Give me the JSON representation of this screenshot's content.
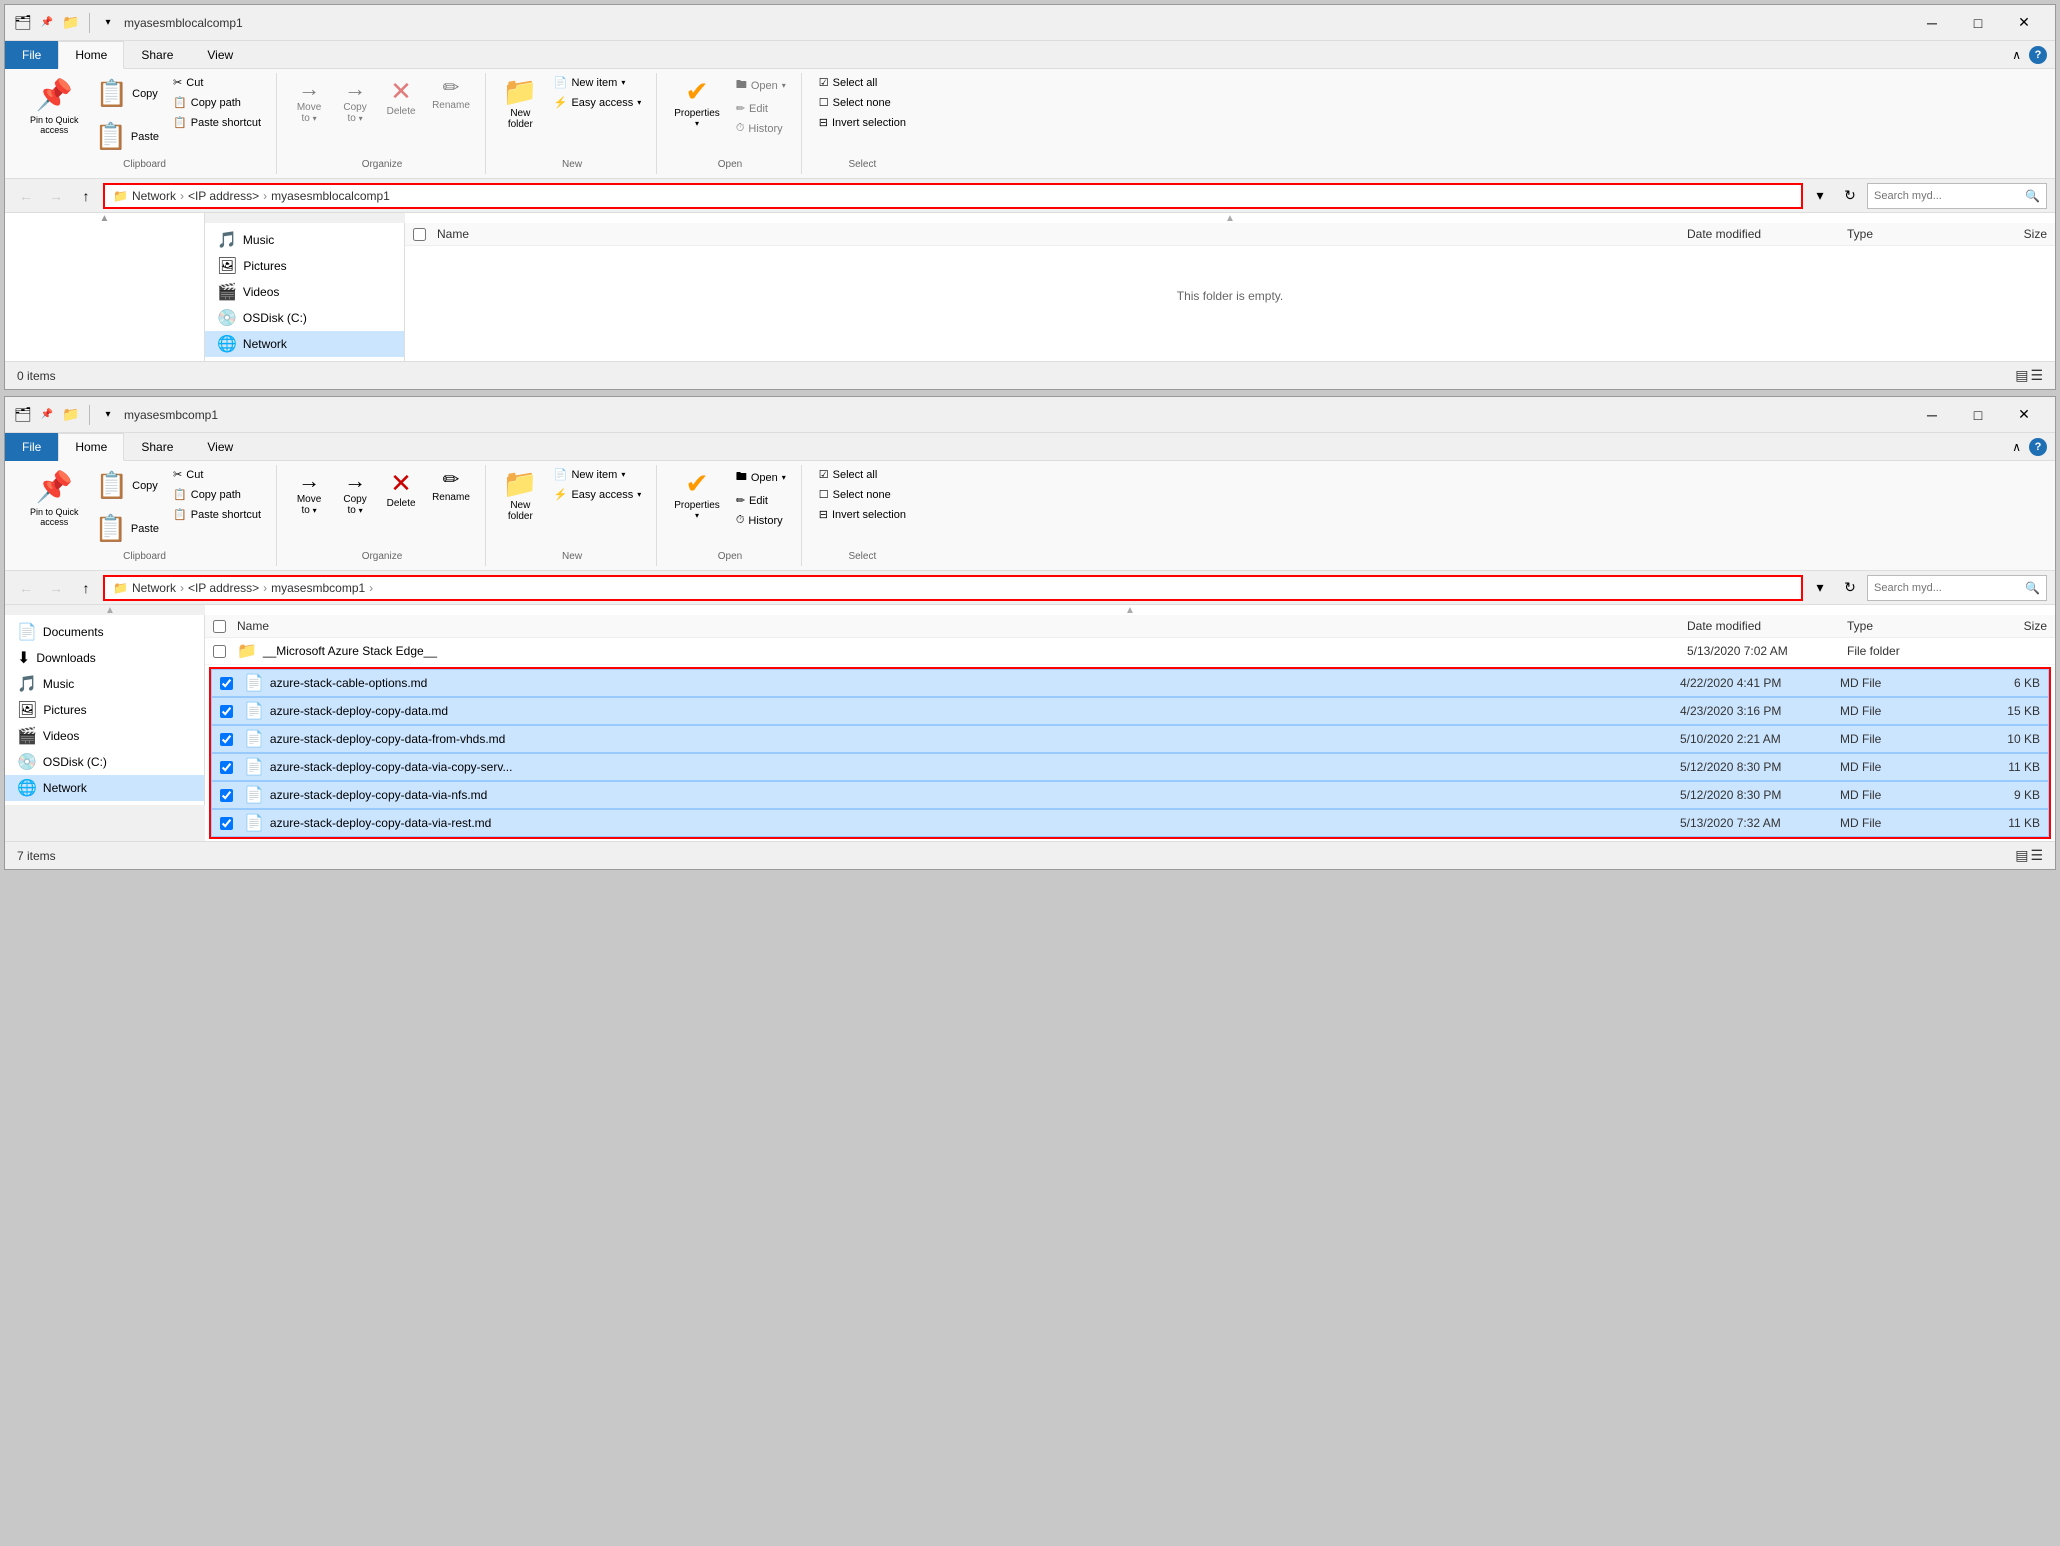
{
  "window1": {
    "title": "myasesmblocalcomp1",
    "tabs": [
      "File",
      "Home",
      "Share",
      "View"
    ],
    "active_tab": "Home",
    "ribbon": {
      "groups": {
        "clipboard": {
          "label": "Clipboard",
          "buttons": [
            {
              "id": "pin",
              "icon": "📌",
              "label": "Pin to Quick\naccess"
            },
            {
              "id": "copy",
              "icon": "📋",
              "label": "Copy"
            },
            {
              "id": "paste",
              "icon": "📋",
              "label": "Paste"
            }
          ],
          "small_buttons": [
            {
              "id": "cut",
              "icon": "✂",
              "label": "Cut"
            },
            {
              "id": "copy-path",
              "icon": "📋",
              "label": "Copy path"
            },
            {
              "id": "paste-shortcut",
              "icon": "📋",
              "label": "Paste shortcut"
            }
          ]
        },
        "organize": {
          "label": "Organize",
          "buttons": [
            {
              "id": "move-to",
              "icon": "→",
              "label": "Move to"
            },
            {
              "id": "copy-to",
              "icon": "→",
              "label": "Copy to"
            },
            {
              "id": "delete",
              "icon": "✕",
              "label": "Delete"
            },
            {
              "id": "rename",
              "icon": "✏",
              "label": "Rename"
            }
          ]
        },
        "new": {
          "label": "New",
          "buttons": [
            {
              "id": "new-folder",
              "icon": "📁",
              "label": "New\nfolder"
            },
            {
              "id": "new-item",
              "icon": "📄",
              "label": "New item"
            },
            {
              "id": "easy-access",
              "icon": "⚡",
              "label": "Easy access"
            }
          ]
        },
        "open": {
          "label": "Open",
          "buttons": [
            {
              "id": "properties",
              "icon": "✔",
              "label": "Properties"
            },
            {
              "id": "open",
              "label": "Open"
            },
            {
              "id": "edit",
              "label": "Edit"
            },
            {
              "id": "history",
              "label": "History"
            }
          ]
        },
        "select": {
          "label": "Select",
          "buttons": [
            {
              "id": "select-all",
              "label": "Select all"
            },
            {
              "id": "select-none",
              "label": "Select none"
            },
            {
              "id": "invert-selection",
              "label": "Invert selection"
            }
          ]
        }
      }
    },
    "address": {
      "path": "Network > <IP address> > myasesmblocalcomp1",
      "crumbs": [
        "Network",
        "<IP address>",
        "myasesmblocalcomp1"
      ],
      "search_placeholder": "Search myd..."
    },
    "sidebar": [
      {
        "icon": "🎵",
        "label": "Music"
      },
      {
        "icon": "🖼",
        "label": "Pictures"
      },
      {
        "icon": "🎬",
        "label": "Videos"
      },
      {
        "icon": "💿",
        "label": "OSDisk (C:)"
      },
      {
        "icon": "🌐",
        "label": "Network",
        "selected": true
      }
    ],
    "columns": [
      "Name",
      "Date modified",
      "Type",
      "Size"
    ],
    "files": [],
    "empty_message": "This folder is empty.",
    "status": "0 items"
  },
  "window2": {
    "title": "myasesmbcomp1",
    "tabs": [
      "File",
      "Home",
      "Share",
      "View"
    ],
    "active_tab": "Home",
    "address": {
      "path": "Network > <IP address> > myasesmbcomp1 >",
      "crumbs": [
        "Network",
        "<IP address>",
        "myasesmbcomp1"
      ],
      "search_placeholder": "Search myd..."
    },
    "sidebar": [
      {
        "icon": "📄",
        "label": "Documents"
      },
      {
        "icon": "⬇",
        "label": "Downloads"
      },
      {
        "icon": "🎵",
        "label": "Music"
      },
      {
        "icon": "🖼",
        "label": "Pictures"
      },
      {
        "icon": "🎬",
        "label": "Videos"
      },
      {
        "icon": "💿",
        "label": "OSDisk (C:)"
      },
      {
        "icon": "🌐",
        "label": "Network",
        "selected": true
      }
    ],
    "columns": [
      "Name",
      "Date modified",
      "Type",
      "Size"
    ],
    "files": [
      {
        "icon": "📁",
        "name": "__Microsoft Azure Stack Edge__",
        "date": "5/13/2020 7:02 AM",
        "type": "File folder",
        "size": "",
        "highlighted": false
      },
      {
        "icon": "📄",
        "name": "azure-stack-cable-options.md",
        "date": "4/22/2020 4:41 PM",
        "type": "MD File",
        "size": "6 KB",
        "highlighted": true
      },
      {
        "icon": "📄",
        "name": "azure-stack-deploy-copy-data.md",
        "date": "4/23/2020 3:16 PM",
        "type": "MD File",
        "size": "15 KB",
        "highlighted": true
      },
      {
        "icon": "📄",
        "name": "azure-stack-deploy-copy-data-from-vhds.md",
        "date": "5/10/2020 2:21 AM",
        "type": "MD File",
        "size": "10 KB",
        "highlighted": true
      },
      {
        "icon": "📄",
        "name": "azure-stack-deploy-copy-data-via-copy-serv...",
        "date": "5/12/2020 8:30 PM",
        "type": "MD File",
        "size": "11 KB",
        "highlighted": true
      },
      {
        "icon": "📄",
        "name": "azure-stack-deploy-copy-data-via-nfs.md",
        "date": "5/12/2020 8:30 PM",
        "type": "MD File",
        "size": "9 KB",
        "highlighted": true
      },
      {
        "icon": "📄",
        "name": "azure-stack-deploy-copy-data-via-rest.md",
        "date": "5/13/2020 7:32 AM",
        "type": "MD File",
        "size": "11 KB",
        "highlighted": true
      }
    ],
    "status": "7 items"
  },
  "labels": {
    "cut": "Cut",
    "copy_path": "Copy path",
    "paste_shortcut": "Paste shortcut",
    "clipboard": "Clipboard",
    "organize": "Organize",
    "new_group": "New",
    "open_group": "Open",
    "select_group": "Select",
    "pin_label": "Pin to Quick\naccess",
    "copy_label": "Copy",
    "paste_label": "Paste",
    "move_to": "Move to",
    "copy_to": "Copy to",
    "delete": "Delete",
    "rename": "Rename",
    "new_folder": "New\nfolder",
    "new_item": "New item",
    "easy_access": "Easy access",
    "properties": "Properties",
    "open": "Open",
    "edit": "Edit",
    "history": "History",
    "select_all": "Select all",
    "select_none": "Select none",
    "invert_selection": "Invert selection",
    "name_col": "Name",
    "date_col": "Date modified",
    "type_col": "Type",
    "size_col": "Size",
    "empty_folder": "This folder is empty."
  }
}
